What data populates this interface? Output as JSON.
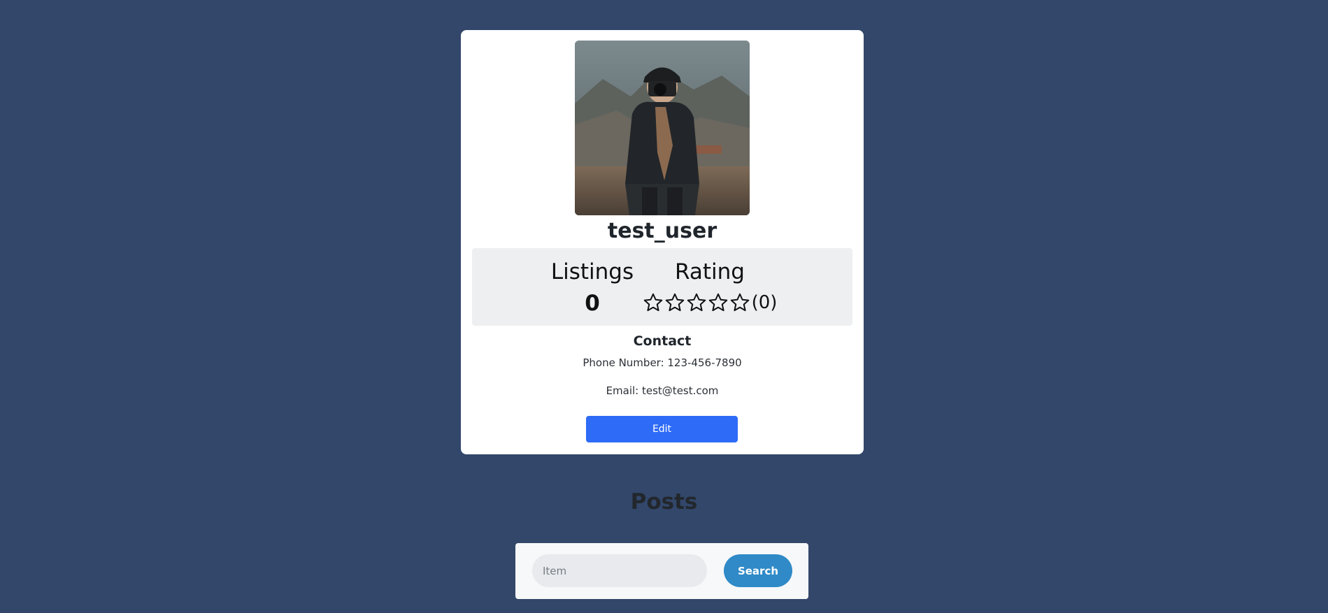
{
  "profile": {
    "username": "test_user",
    "avatar_alt": "photographer-photo"
  },
  "stats": {
    "listings_label": "Listings",
    "listings_value": "0",
    "rating_label": "Rating",
    "rating_stars": 0,
    "rating_max": 5,
    "rating_count": "(0)"
  },
  "contact": {
    "heading": "Contact",
    "phone": "Phone Number: 123-456-7890",
    "email": "Email: test@test.com"
  },
  "actions": {
    "edit_label": "Edit"
  },
  "posts": {
    "heading": "Posts",
    "search_placeholder": "Item",
    "search_value": "",
    "search_label": "Search"
  },
  "colors": {
    "background": "#32476a",
    "edit_button": "#2e6bf6",
    "search_button": "#2f8ac7"
  }
}
